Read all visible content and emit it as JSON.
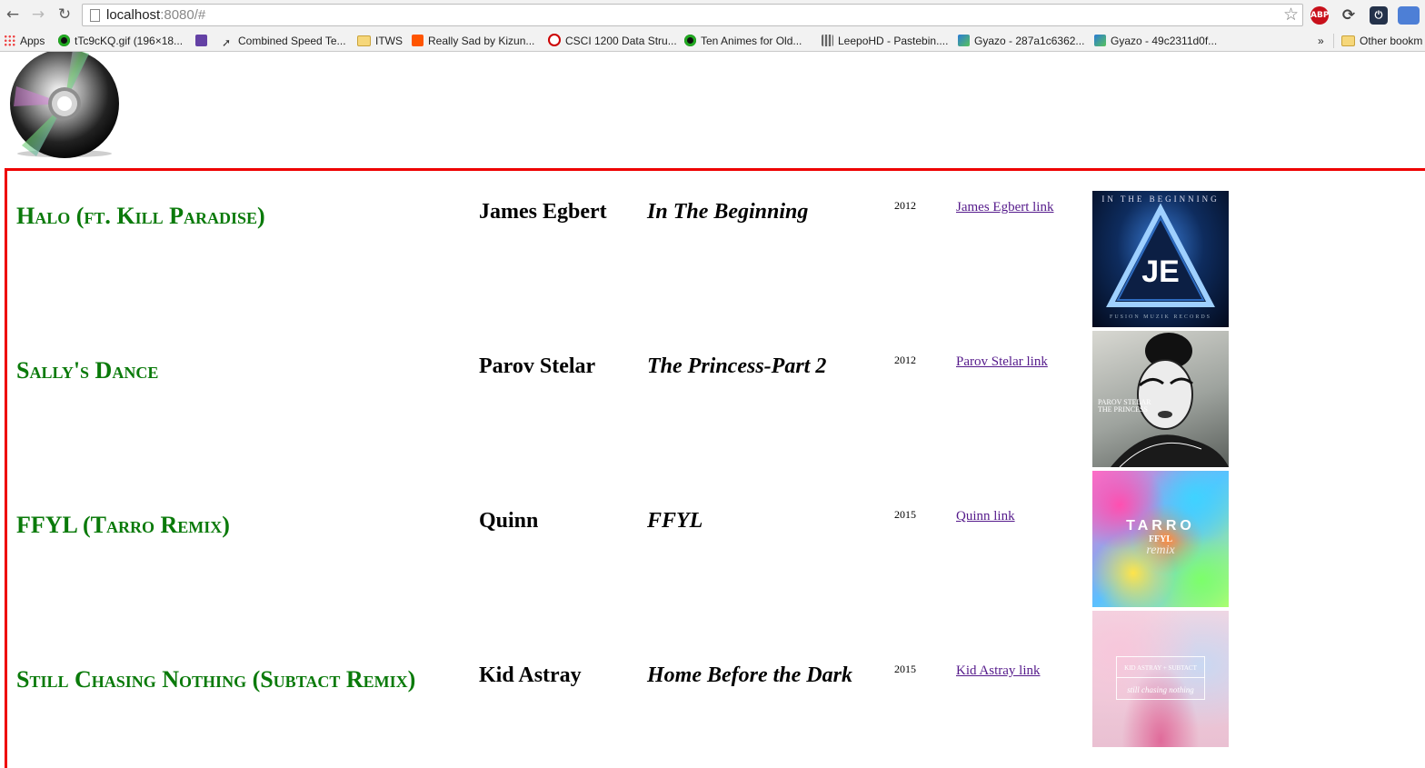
{
  "browser": {
    "url_host": "localhost",
    "url_rest": ":8080/#",
    "extensions": [
      {
        "name": "adblock-plus-icon",
        "label": "ABP"
      }
    ],
    "bookmarks": [
      {
        "label": "Apps",
        "icon": "apps-grid-icon"
      },
      {
        "label": "tTc9cKQ.gif (196×18...",
        "icon": "green-circle-icon"
      },
      {
        "label": "",
        "icon": "twitch-icon"
      },
      {
        "label": "Combined Speed Te...",
        "icon": "speed-icon"
      },
      {
        "label": "ITWS",
        "icon": "folder-icon"
      },
      {
        "label": "Really Sad by Kizun...",
        "icon": "soundcloud-icon"
      },
      {
        "label": "CSCI 1200 Data Stru...",
        "icon": "cs-icon"
      },
      {
        "label": "Ten Animes for Old...",
        "icon": "green-circle-icon"
      },
      {
        "label": "LeepoHD - Pastebin....",
        "icon": "pastebin-icon"
      },
      {
        "label": "Gyazo - 287a1c6362...",
        "icon": "gyazo-icon"
      },
      {
        "label": "Gyazo - 49c2311d0f...",
        "icon": "gyazo-icon"
      }
    ],
    "overflow_label": "»",
    "other_bookmarks": "Other bookm"
  },
  "songs": [
    {
      "title": "Halo (ft. Kill Paradise)",
      "artist": "James Egbert",
      "album": "In The Beginning",
      "year": "2012",
      "link": "James Egbert link",
      "cover_top": "IN THE BEGINNING",
      "cover_mid": "JE",
      "cover_bottom": "FUSION MUZIK RECORDS"
    },
    {
      "title": "Sally's Dance",
      "artist": "Parov Stelar",
      "album": "The Princess-Part 2",
      "year": "2012",
      "link": "Parov Stelar link",
      "cover_top": "PAROV STELAR",
      "cover_mid": "THE PRINCESS",
      "cover_bottom": ""
    },
    {
      "title": "FFYL (Tarro Remix)",
      "artist": "Quinn",
      "album": "FFYL",
      "year": "2015",
      "link": "Quinn link",
      "cover_top": "TARRO",
      "cover_mid": "FFYL",
      "cover_bottom": "remix"
    },
    {
      "title": "Still Chasing Nothing (Subtact Remix)",
      "artist": "Kid Astray",
      "album": "Home Before the Dark",
      "year": "2015",
      "link": "Kid Astray link",
      "cover_top": "KID ASTRAY + SUBTACT",
      "cover_mid": "still chasing nothing",
      "cover_bottom": ""
    }
  ]
}
